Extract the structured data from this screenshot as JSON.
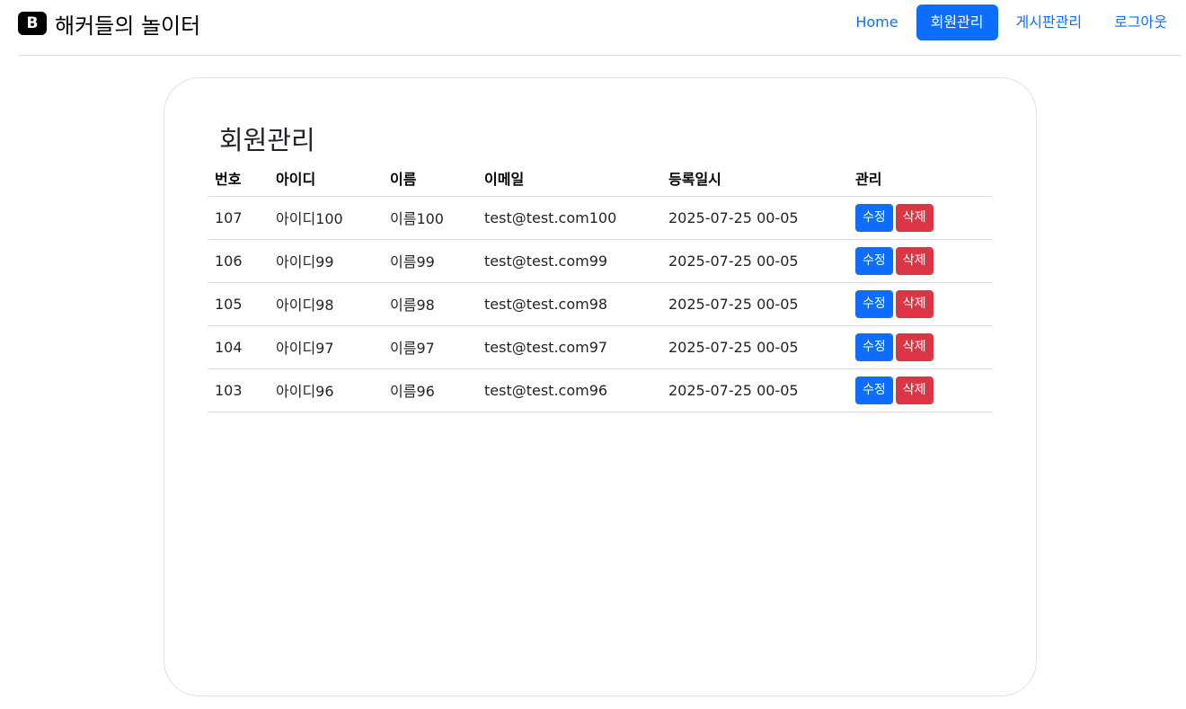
{
  "brand": {
    "logo_letter": "B",
    "title": "해커들의 놀이터"
  },
  "nav": {
    "items": [
      {
        "label": "Home"
      },
      {
        "label": "회원관리"
      },
      {
        "label": "게시판관리"
      },
      {
        "label": "로그아웃"
      }
    ],
    "active_index": 1
  },
  "main": {
    "title": "회원관리",
    "table": {
      "columns": [
        "번호",
        "아이디",
        "이름",
        "이메일",
        "등록일시",
        "관리"
      ],
      "rows": [
        {
          "no": "107",
          "id": "아이디100",
          "name": "이름100",
          "email": "test@test.com100",
          "date": "2025-07-25 00-05"
        },
        {
          "no": "106",
          "id": "아이디99",
          "name": "이름99",
          "email": "test@test.com99",
          "date": "2025-07-25 00-05"
        },
        {
          "no": "105",
          "id": "아이디98",
          "name": "이름98",
          "email": "test@test.com98",
          "date": "2025-07-25 00-05"
        },
        {
          "no": "104",
          "id": "아이디97",
          "name": "이름97",
          "email": "test@test.com97",
          "date": "2025-07-25 00-05"
        },
        {
          "no": "103",
          "id": "아이디96",
          "name": "이름96",
          "email": "test@test.com96",
          "date": "2025-07-25 00-05"
        }
      ],
      "edit_label": "수정",
      "delete_label": "삭제"
    }
  },
  "colors": {
    "primary": "#0d6efd",
    "danger": "#dc3545",
    "border": "#dee2e6"
  }
}
